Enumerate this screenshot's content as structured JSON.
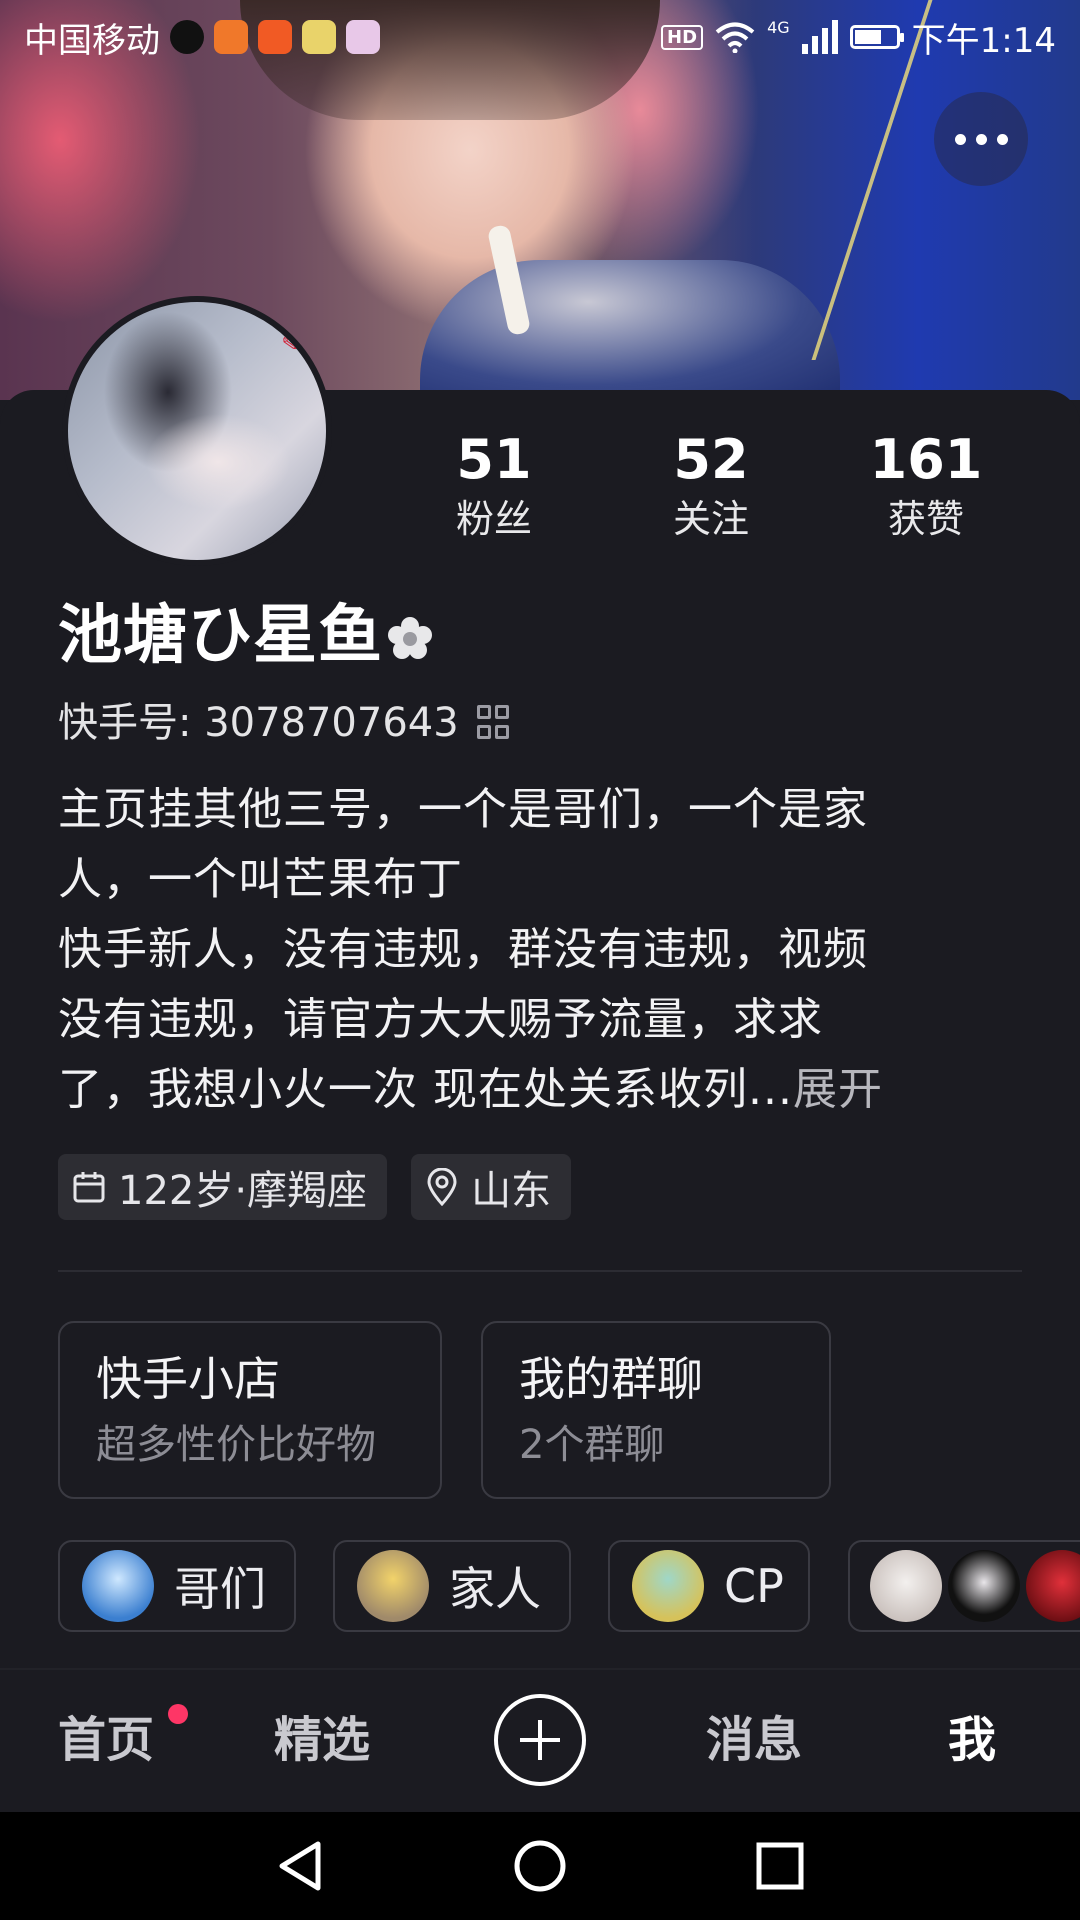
{
  "status_bar": {
    "carrier": "中国移动",
    "network": "4G",
    "hd": "HD",
    "time": "下午1:14"
  },
  "profile": {
    "stats": [
      {
        "value": "51",
        "label": "粉丝"
      },
      {
        "value": "52",
        "label": "关注"
      },
      {
        "value": "161",
        "label": "获赞"
      }
    ],
    "name": "池塘ひ星鱼",
    "id_label": "快手号: 3078707643",
    "bio_lines": [
      "主页挂其他三号，一个是哥们，一个是家",
      "人，一个叫芒果布丁",
      "快手新人，没有违规，群没有违规，视频",
      "没有违规，请官方大大赐予流量，求求",
      "了，我想小火一次 现在处关系收列..."
    ],
    "expand_label": "展开",
    "tags": {
      "age": "122岁·摩羯座",
      "location": "山东"
    }
  },
  "features": [
    {
      "title": "快手小店",
      "subtitle": "超多性价比好物"
    },
    {
      "title": "我的群聊",
      "subtitle": "2个群聊"
    }
  ],
  "groups": [
    {
      "name": "哥们",
      "color": "#3b7fd0"
    },
    {
      "name": "家人",
      "color": "#a08a6a"
    },
    {
      "name": "CP",
      "color": "#d6c25a"
    }
  ],
  "tabbar": {
    "home": "首页",
    "featured": "精选",
    "messages": "消息",
    "me": "我"
  },
  "colors": {
    "background": "#1b1b21",
    "badge_red": "#fe3666",
    "muted_text": "#8d8d95"
  },
  "icons": [
    "more-icon",
    "qr-code-icon",
    "calendar-icon",
    "location-pin-icon",
    "plus-icon",
    "back-icon",
    "home-icon",
    "recents-icon"
  ]
}
